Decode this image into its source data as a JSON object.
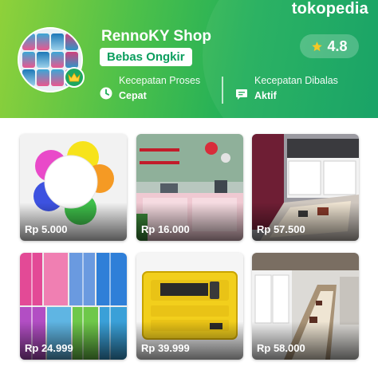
{
  "brand": "tokopedia",
  "shop": {
    "name": "RennoKY Shop",
    "badge": "Bebas Ongkir",
    "rating": "4.8"
  },
  "stats": [
    {
      "label": "Kecepatan Proses",
      "value": "Cepat",
      "icon": "clock-icon"
    },
    {
      "label": "Kecepatan Dibalas",
      "value": "Aktif",
      "icon": "chat-icon"
    }
  ],
  "products": [
    {
      "price": "Rp 5.000",
      "image": "flower-sticky-notes"
    },
    {
      "price": "Rp 16.000",
      "image": "kitchen-shelf"
    },
    {
      "price": "Rp 57.500",
      "image": "kitchen-mat"
    },
    {
      "price": "Rp 24.999",
      "image": "curtains"
    },
    {
      "price": "Rp 39.999",
      "image": "hacksaw"
    },
    {
      "price": "Rp 58.000",
      "image": "hallway-runner"
    }
  ],
  "colors": {
    "brand_green": "#0b9e5e",
    "star": "#f5c518"
  }
}
